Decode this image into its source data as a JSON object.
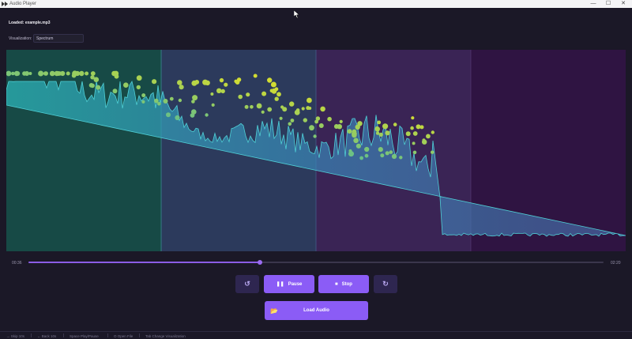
{
  "window": {
    "title": "Audio Player",
    "minimize": "—",
    "maximize": "☐",
    "close": "✕"
  },
  "status": {
    "loaded_prefix": "Loaded:",
    "loaded_file": "example.mp3"
  },
  "visualization": {
    "label": "Visualization:",
    "selected": "Spectrum"
  },
  "playback": {
    "current_time": "00:36",
    "total_time": "02:20",
    "progress_fraction": 0.402
  },
  "buttons": {
    "back": "↺",
    "pause_icon": "❚❚",
    "pause": "Pause",
    "stop_icon": "■",
    "stop": "Stop",
    "forward": "↻",
    "load": "Load Audio",
    "load_icon": "📂"
  },
  "shortcuts": [
    "→ Skip 10s",
    "← Back 10s",
    "Space Play/Pause",
    "O Open File",
    "Tab Change Visualization"
  ],
  "colors": {
    "accent": "#8b5cf6",
    "background": "#1b1827"
  }
}
